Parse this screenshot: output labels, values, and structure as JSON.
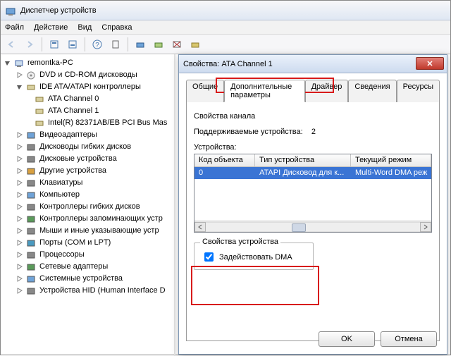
{
  "window": {
    "title": "Диспетчер устройств"
  },
  "menu": {
    "file": "Файл",
    "action": "Действие",
    "view": "Вид",
    "help": "Справка"
  },
  "tree": {
    "root": "remontka-PC",
    "dvd": "DVD и CD-ROM дисководы",
    "ide": "IDE ATA/ATAPI контроллеры",
    "ide_children": {
      "c0": "ATA Channel 0",
      "c1": "ATA Channel 1",
      "intel": "Intel(R) 82371AB/EB PCI Bus Mas"
    },
    "video": "Видеоадаптеры",
    "floppy_drives": "Дисководы гибких дисков",
    "disk": "Дисковые устройства",
    "other": "Другие устройства",
    "keyboard": "Клавиатуры",
    "computer": "Компьютер",
    "floppy_ctrl": "Контроллеры гибких дисков",
    "storage_ctrl": "Контроллеры запоминающих устр",
    "mice": "Мыши и иные указывающие устр",
    "ports": "Порты (COM и LPT)",
    "cpu": "Процессоры",
    "net": "Сетевые адаптеры",
    "system": "Системные устройства",
    "hid": "Устройства HID (Human Interface D"
  },
  "dialog": {
    "title": "Свойства: ATA Channel 1",
    "tabs": {
      "general": "Общие",
      "advanced": "Дополнительные параметры",
      "driver": "Драйвер",
      "details": "Сведения",
      "resources": "Ресурсы"
    },
    "channel_props_label": "Свойства канала",
    "supported_devices_label": "Поддерживаемые устройства:",
    "supported_devices_value": "2",
    "devices_label": "Устройства:",
    "columns": {
      "id": "Код объекта",
      "type": "Тип устройства",
      "mode": "Текущий режим"
    },
    "row": {
      "id": "0",
      "type": "ATAPI Дисковод для к...",
      "mode": "Multi-Word DMA реж"
    },
    "device_props_label": "Свойства устройства",
    "enable_dma_label": "Задействовать DMA",
    "ok": "OK",
    "cancel": "Отмена"
  }
}
